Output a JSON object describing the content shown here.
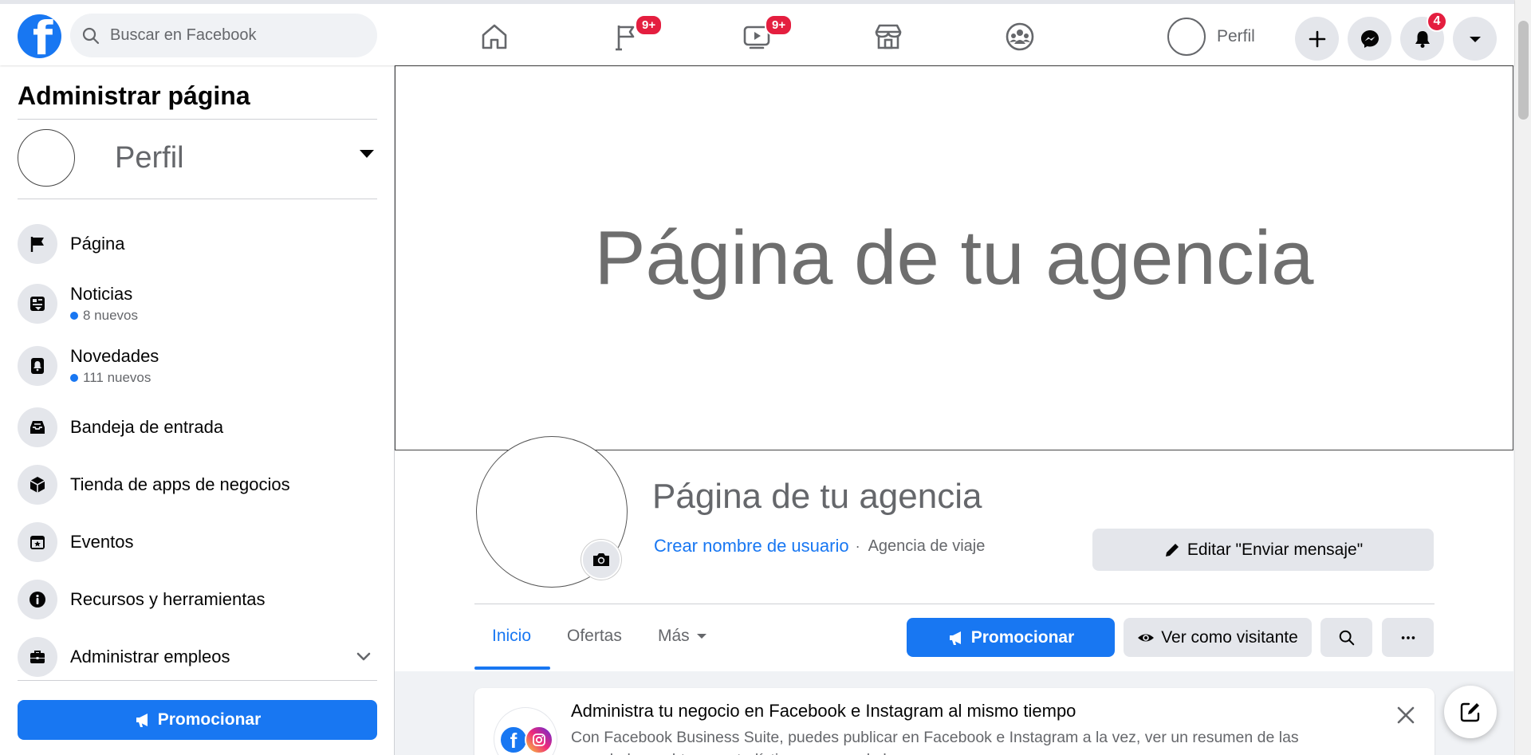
{
  "topbar": {
    "logo": "f",
    "search_placeholder": "Buscar en Facebook",
    "nav": [
      {
        "icon": "home-icon"
      },
      {
        "icon": "pages-flag-icon",
        "badge": "9+"
      },
      {
        "icon": "watch-icon",
        "badge": "9+"
      },
      {
        "icon": "marketplace-icon"
      },
      {
        "icon": "groups-icon"
      }
    ],
    "profile_label": "Perfil",
    "notifications_badge": "4"
  },
  "sidebar": {
    "title": "Administrar página",
    "profile_name": "Perfil",
    "items": [
      {
        "label": "Página",
        "icon": "flag-icon"
      },
      {
        "label": "Noticias",
        "sub": "8 nuevos",
        "icon": "news-icon"
      },
      {
        "label": "Novedades",
        "sub": "111 nuevos",
        "icon": "bell-icon"
      },
      {
        "label": "Bandeja de entrada",
        "icon": "inbox-icon"
      },
      {
        "label": "Tienda de apps de negocios",
        "icon": "cube-icon"
      },
      {
        "label": "Eventos",
        "icon": "calendar-star-icon"
      },
      {
        "label": "Recursos y herramientas",
        "icon": "info-icon"
      },
      {
        "label": "Administrar empleos",
        "icon": "briefcase-icon"
      }
    ],
    "promote_label": "Promocionar"
  },
  "cover": {
    "text": "Página de tu agencia"
  },
  "page": {
    "name": "Página de tu agencia",
    "username_link": "Crear nombre de usuario",
    "separator": "·",
    "category": "Agencia de viaje",
    "edit_button": "Editar \"Enviar mensaje\"",
    "tabs": [
      "Inicio",
      "Ofertas",
      "Más"
    ],
    "promote_button": "Promocionar",
    "view_as_button": "Ver como visitante"
  },
  "card": {
    "title": "Administra tu negocio en Facebook e Instagram al mismo tiempo",
    "body": "Con Facebook Business Suite, puedes publicar en Facebook e Instagram a la vez, ver un resumen de las novedades y obtener estadísticas en un solo lugar."
  },
  "colors": {
    "brand": "#1877f2",
    "badge": "#e41e3f",
    "secondary_text": "#65676b"
  }
}
